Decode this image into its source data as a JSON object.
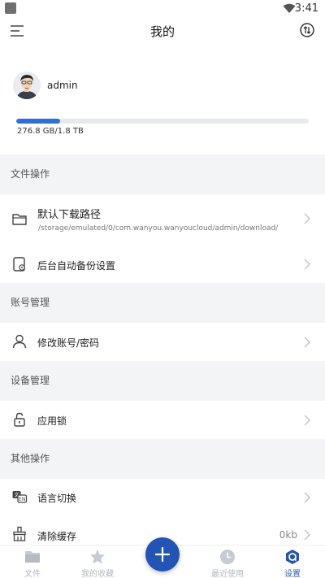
{
  "status_bar": {
    "time": "3:41"
  },
  "header": {
    "title": "我的"
  },
  "profile": {
    "username": "admin",
    "storage_text": "276.8 GB/1.8 TB",
    "storage_used_fraction": 0.15
  },
  "sections": {
    "file_ops": {
      "title": "文件操作",
      "download_path": {
        "label": "默认下载路径",
        "value": "/storage/emulated/0/com.wanyou.wanyoucloud/admin/download/"
      },
      "backup": {
        "label": "后台自动备份设置"
      }
    },
    "account": {
      "title": "账号管理",
      "change_password": {
        "label": "修改账号/密码"
      }
    },
    "device": {
      "title": "设备管理",
      "app_lock": {
        "label": "应用锁"
      }
    },
    "other": {
      "title": "其他操作",
      "language": {
        "label": "语言切换"
      },
      "clear_cache": {
        "label": "清除缓存",
        "value": "0kb"
      }
    }
  },
  "bottom_nav": {
    "files": "文件",
    "favorites": "我的收藏",
    "recent": "最近使用",
    "settings": "设置"
  },
  "colors": {
    "accent": "#2f6fd6",
    "fab": "#2353b5",
    "section_bg": "#f3f4f6"
  }
}
